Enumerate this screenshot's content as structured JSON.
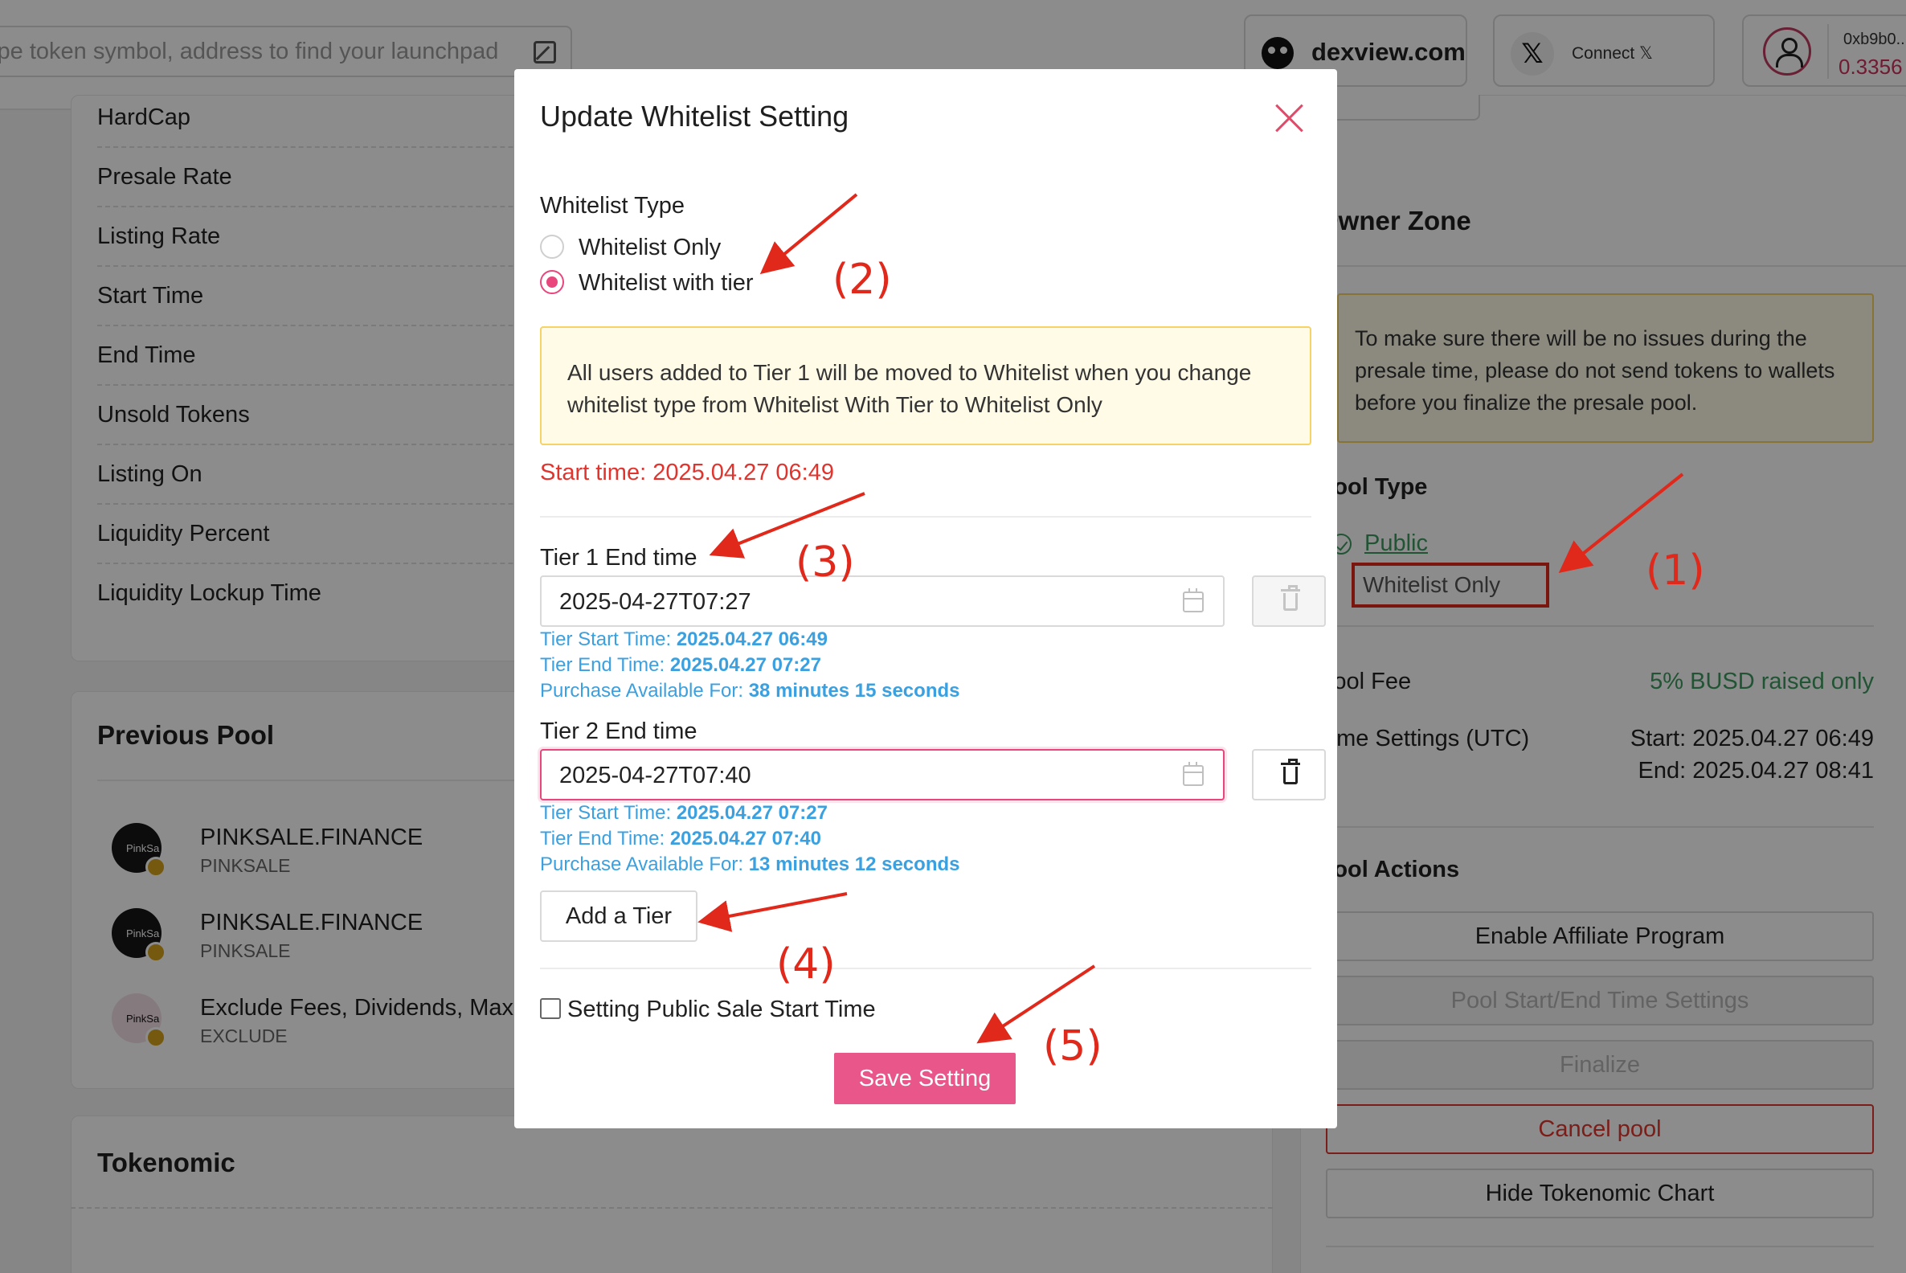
{
  "header": {
    "search_placeholder": "ype token symbol, address to find your launchpad",
    "dexview_label": "dexview.com",
    "x_icon_glyph": "𝕏",
    "connect_label": "Connect 𝕏",
    "wallet_address": "0xb9b0...",
    "wallet_balance": "0.3356"
  },
  "pool_details": {
    "rows": [
      "HardCap",
      "Presale Rate",
      "Listing Rate",
      "Start Time",
      "End Time",
      "Unsold Tokens",
      "Listing On",
      "Liquidity Percent",
      "Liquidity Lockup Time"
    ]
  },
  "previous_pool": {
    "title": "Previous Pool",
    "items": [
      {
        "name": "PINKSALE.FINANCE",
        "symbol": "PINKSALE",
        "logo_text": "PinkSa"
      },
      {
        "name": "PINKSALE.FINANCE",
        "symbol": "PINKSALE",
        "logo_text": "PinkSa"
      },
      {
        "name": "Exclude Fees, Dividends, Max",
        "symbol": "EXCLUDE",
        "logo_text": "PinkSa"
      }
    ]
  },
  "tokenomic": {
    "title": "Tokenomic"
  },
  "owner_zone": {
    "title": "Owner Zone",
    "warning": "To make sure there will be no issues during the presale time, please do not send tokens to wallets before you finalize the presale pool.",
    "pool_type_title": "Pool Type",
    "pool_type_public": "Public",
    "pool_type_whitelist": "Whitelist Only",
    "pool_fee_label": "Pool Fee",
    "pool_fee_value": "5% BUSD raised only",
    "time_settings_label": "Time Settings (UTC)",
    "time_start": "Start: 2025.04.27 06:49",
    "time_end": "End: 2025.04.27 08:41",
    "pool_actions_title": "Pool Actions",
    "actions": [
      "Enable Affiliate Program",
      "Pool Start/End Time Settings",
      "Finalize",
      "Cancel pool",
      "Hide Tokenomic Chart"
    ]
  },
  "modal": {
    "title": "Update Whitelist Setting",
    "whitelist_type_label": "Whitelist Type",
    "options": [
      "Whitelist Only",
      "Whitelist with tier"
    ],
    "selected_option": "Whitelist with tier",
    "notice": "All users added to Tier 1 will be moved to Whitelist when you change whitelist type from Whitelist With Tier to Whitelist Only",
    "start_time": "Start time: 2025.04.27 06:49",
    "tiers": [
      {
        "label": "Tier 1 End time",
        "value": "2025-04-27T07:27",
        "start_label": "Tier Start Time:",
        "start_value": "2025.04.27 06:49",
        "end_label": "Tier End Time:",
        "end_value": "2025.04.27 07:27",
        "avail_label": "Purchase Available For:",
        "avail_value": "38 minutes 15 seconds"
      },
      {
        "label": "Tier 2 End time",
        "value": "2025-04-27T07:40",
        "start_label": "Tier Start Time:",
        "start_value": "2025.04.27 07:27",
        "end_label": "Tier End Time:",
        "end_value": "2025.04.27 07:40",
        "avail_label": "Purchase Available For:",
        "avail_value": "13 minutes 12 seconds"
      }
    ],
    "add_tier_label": "Add a Tier",
    "public_sale_label": "Setting Public Sale Start Time",
    "public_sale_checked": false,
    "save_label": "Save Setting"
  },
  "annotations": [
    "(1)",
    "(2)",
    "(3)",
    "(4)",
    "(5)"
  ],
  "colors": {
    "accent": "#e9568a",
    "annotation": "#e0281b",
    "info": "#3aa0e0",
    "success": "#3c9a5f"
  }
}
